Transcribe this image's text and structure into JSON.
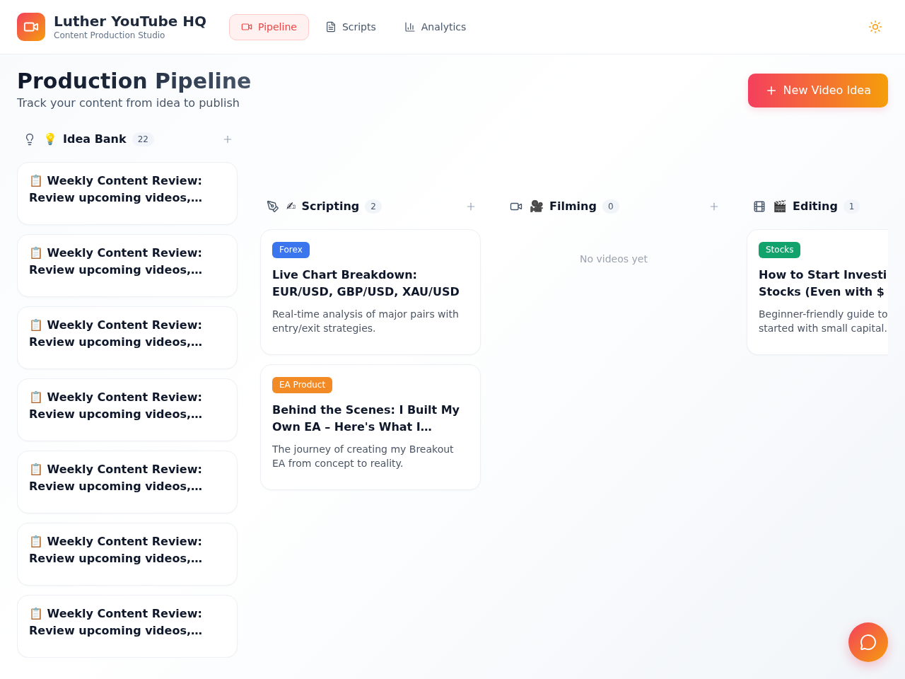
{
  "app": {
    "title": "Luther YouTube HQ",
    "subtitle": "Content Production Studio"
  },
  "nav": [
    {
      "label": "Pipeline",
      "selected": true
    },
    {
      "label": "Scripts",
      "selected": false
    },
    {
      "label": "Analytics",
      "selected": false
    }
  ],
  "page": {
    "title": "Production Pipeline",
    "subtitle": "Track your content from idea to publish",
    "action": "New Video Idea"
  },
  "columns": [
    {
      "emoji": "💡",
      "title": "Idea Bank",
      "count": "22",
      "add_button": true,
      "cards": [
        {
          "title": "📋 Weekly Content Review: Review upcoming videos,…"
        },
        {
          "title": "📋 Weekly Content Review: Review upcoming videos,…"
        },
        {
          "title": "📋 Weekly Content Review: Review upcoming videos,…"
        },
        {
          "title": "📋 Weekly Content Review: Review upcoming videos,…"
        },
        {
          "title": "📋 Weekly Content Review: Review upcoming videos,…"
        },
        {
          "title": "📋 Weekly Content Review: Review upcoming videos,…"
        },
        {
          "title": "📋 Weekly Content Review: Review upcoming videos,…"
        }
      ]
    },
    {
      "emoji": "✍",
      "title": "Scripting",
      "count": "2",
      "add_button": true,
      "cards": [
        {
          "tag": {
            "label": "Forex",
            "color": "#3b76ef"
          },
          "title": "Live Chart Breakdown: EUR/USD, GBP/USD, XAU/USD",
          "description": "Real-time analysis of major pairs with entry/exit strategies."
        },
        {
          "tag": {
            "label": "EA Product",
            "color": "#f28a26"
          },
          "title": "Behind the Scenes: I Built My Own EA – Here's What I…",
          "description": "The journey of creating my Breakout EA from concept to reality."
        }
      ]
    },
    {
      "emoji": "🎥",
      "title": "Filming",
      "count": "0",
      "add_button": true,
      "empty_text": "No videos yet"
    },
    {
      "emoji": "🎬",
      "title": "Editing",
      "count": "1",
      "add_button": false,
      "cards": [
        {
          "tag": {
            "label": "Stocks",
            "color": "#12a36d"
          },
          "title": "How to Start Investi\nStocks (Even with $",
          "description": "Beginner-friendly guide to\nstarted with small capital."
        }
      ]
    }
  ]
}
